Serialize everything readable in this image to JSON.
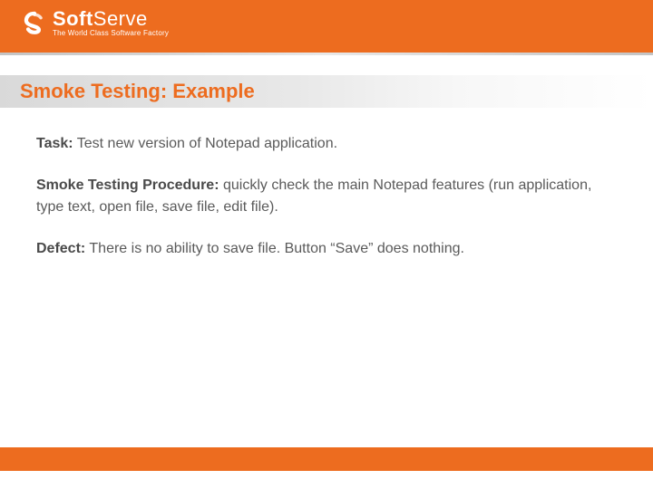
{
  "header": {
    "logo_name": "SoftServe",
    "logo_name_bold": "Soft",
    "logo_name_light": "Serve",
    "tagline": "The World Class Software Factory"
  },
  "slide": {
    "title": "Smoke Testing: Example"
  },
  "body": {
    "task_label": "Task:",
    "task_text": " Test new version of Notepad application.",
    "procedure_label": "Smoke Testing Procedure:",
    "procedure_text": " quickly check the main Notepad features (run application, type text, open file, save file, edit file).",
    "defect_label": "Defect:",
    "defect_text": " There is no ability to save file. Button “Save” does nothing."
  }
}
